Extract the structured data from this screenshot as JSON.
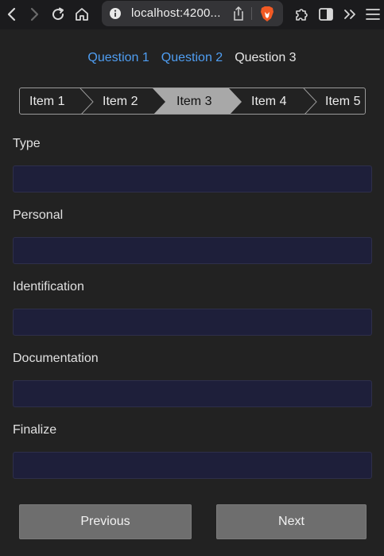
{
  "browser": {
    "url": "localhost:4200..."
  },
  "question_tabs": [
    {
      "label": "Question 1",
      "state": "link"
    },
    {
      "label": "Question 2",
      "state": "link"
    },
    {
      "label": "Question 3",
      "state": "current"
    }
  ],
  "steps": [
    {
      "label": "Item 1",
      "active": false
    },
    {
      "label": "Item 2",
      "active": false
    },
    {
      "label": "Item 3",
      "active": true
    },
    {
      "label": "Item 4",
      "active": false
    },
    {
      "label": "Item 5",
      "active": false
    }
  ],
  "fields": [
    {
      "label": "Type",
      "value": ""
    },
    {
      "label": "Personal",
      "value": ""
    },
    {
      "label": "Identification",
      "value": ""
    },
    {
      "label": "Documentation",
      "value": ""
    },
    {
      "label": "Finalize",
      "value": ""
    }
  ],
  "buttons": {
    "previous": "Previous",
    "next": "Next"
  },
  "colors": {
    "link": "#4f9ef2",
    "active_step": "#a8a8a8",
    "input_bg": "#1e1f3a",
    "button_bg": "#6e6e6e",
    "page_bg": "#222222"
  },
  "icons": {
    "back": "chevron-left-icon",
    "forward": "chevron-right-icon",
    "reload": "reload-icon",
    "home": "home-icon",
    "site_info": "info-icon",
    "share": "share-icon",
    "brave_shield": "brave-lion-icon",
    "extensions": "puzzle-icon",
    "sidebar": "sidebar-icon",
    "more": "double-chevron-icon",
    "menu": "hamburger-icon"
  }
}
